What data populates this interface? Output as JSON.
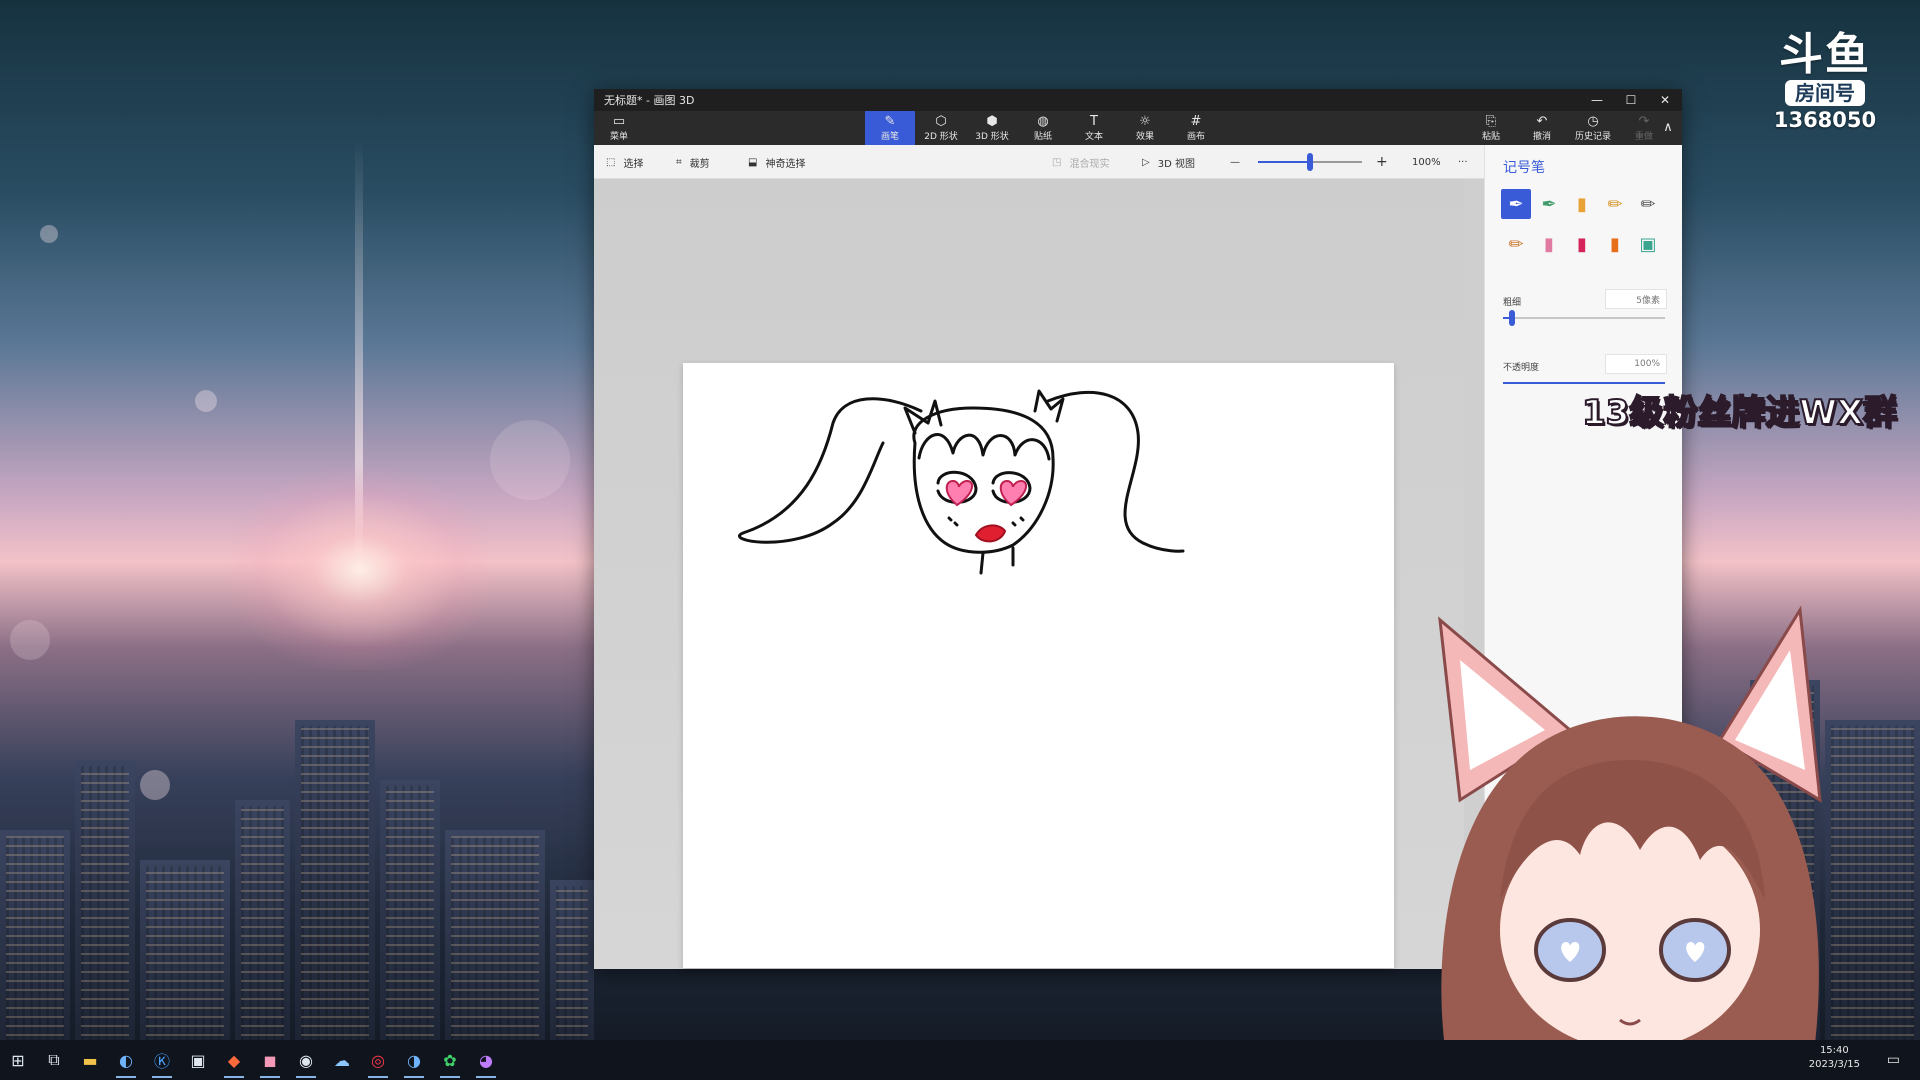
{
  "window": {
    "title": "无标题* - 画图 3D",
    "minimize_icon": "—",
    "maximize_icon": "☐",
    "close_icon": "✕"
  },
  "ribbon": {
    "menu": {
      "label": "菜单",
      "icon": "▭"
    },
    "tools": [
      {
        "label": "画笔",
        "icon": "✎",
        "active": true
      },
      {
        "label": "2D 形状",
        "icon": "⬡"
      },
      {
        "label": "3D 形状",
        "icon": "⬢"
      },
      {
        "label": "贴纸",
        "icon": "◍"
      },
      {
        "label": "文本",
        "icon": "T"
      },
      {
        "label": "效果",
        "icon": "☼"
      },
      {
        "label": "画布",
        "icon": "#"
      }
    ],
    "right_tools": [
      {
        "label": "粘贴",
        "icon": "⎘"
      },
      {
        "label": "撤消",
        "icon": "↶"
      },
      {
        "label": "历史记录",
        "icon": "◷"
      },
      {
        "label": "重做",
        "icon": "↷",
        "disabled": true
      }
    ],
    "collapse_icon": "∧"
  },
  "subbar": {
    "select": {
      "label": "选择",
      "icon": "⬚"
    },
    "crop": {
      "label": "裁剪",
      "icon": "⌗"
    },
    "magic_select": {
      "label": "神奇选择",
      "icon": "⬓"
    },
    "mixed_reality": {
      "label": "混合现实",
      "icon": "◳"
    },
    "view3d": {
      "label": "3D 视图",
      "icon": "▷"
    },
    "zoom_out": "—",
    "zoom_in": "+",
    "zoom_level": "100%",
    "zoom_slider_fraction": 0.5,
    "more": "···"
  },
  "panel": {
    "title": "记号笔",
    "brushes": [
      {
        "name": "marker-brush",
        "icon": "✒",
        "color": "#ffffff",
        "selected": true
      },
      {
        "name": "calligraphy-pen-brush",
        "icon": "✒",
        "color": "#3f9b6a"
      },
      {
        "name": "oil-brush",
        "icon": "▮",
        "color": "#e8a236"
      },
      {
        "name": "watercolor-brush",
        "icon": "✏",
        "color": "#d8942b"
      },
      {
        "name": "pixel-pen-brush",
        "icon": "✏",
        "color": "#555555"
      },
      {
        "name": "pencil-brush",
        "icon": "✏",
        "color": "#cc7a30"
      },
      {
        "name": "eraser-brush",
        "icon": "▮",
        "color": "#e07aa0"
      },
      {
        "name": "crayon-brush",
        "icon": "▮",
        "color": "#d6245a"
      },
      {
        "name": "spray-can-brush",
        "icon": "▮",
        "color": "#e76e1a"
      },
      {
        "name": "fill-brush",
        "icon": "▣",
        "color": "#3aa58f"
      }
    ],
    "thickness": {
      "label": "粗细",
      "value": "5像素",
      "fraction": 0.04
    },
    "opacity": {
      "label": "不透明度",
      "value": "100%",
      "fraction": 1.0
    }
  },
  "overlay": {
    "platform_logo_text": "斗鱼",
    "room_label": "房间号",
    "room_number": "1368050",
    "fan_message": "13级粉丝牌进WX群"
  },
  "taskbar": {
    "items": [
      {
        "name": "start-icon",
        "icon": "⊞"
      },
      {
        "name": "task-view-icon",
        "icon": "⧉"
      },
      {
        "name": "file-explorer-icon",
        "icon": "▬"
      },
      {
        "name": "browser-icon",
        "icon": "◐",
        "running": true
      },
      {
        "name": "app-k-icon",
        "icon": "Ⓚ",
        "running": true
      },
      {
        "name": "app-window-icon",
        "icon": "▣"
      },
      {
        "name": "app-fire-icon",
        "icon": "◆",
        "running": true
      },
      {
        "name": "app-pink-icon",
        "icon": "◼",
        "running": true
      },
      {
        "name": "obs-icon",
        "icon": "◉",
        "running": true
      },
      {
        "name": "app-cloud-icon",
        "icon": "☁"
      },
      {
        "name": "app-red-icon",
        "icon": "◎",
        "running": true
      },
      {
        "name": "app-swirl-icon",
        "icon": "◑",
        "running": true
      },
      {
        "name": "wechat-icon",
        "icon": "✿",
        "running": true
      },
      {
        "name": "paint3d-icon",
        "icon": "◕",
        "running": true
      }
    ],
    "clock_time": "15:40",
    "clock_date": "2023/3/15",
    "notify_icon": "▭"
  },
  "colors": {
    "accent": "#3a5bd8",
    "ribbon_bg": "#2b2b2b",
    "ink": "#111111",
    "heart_pink": "#ff7fb0",
    "lip_red": "#e02030"
  }
}
